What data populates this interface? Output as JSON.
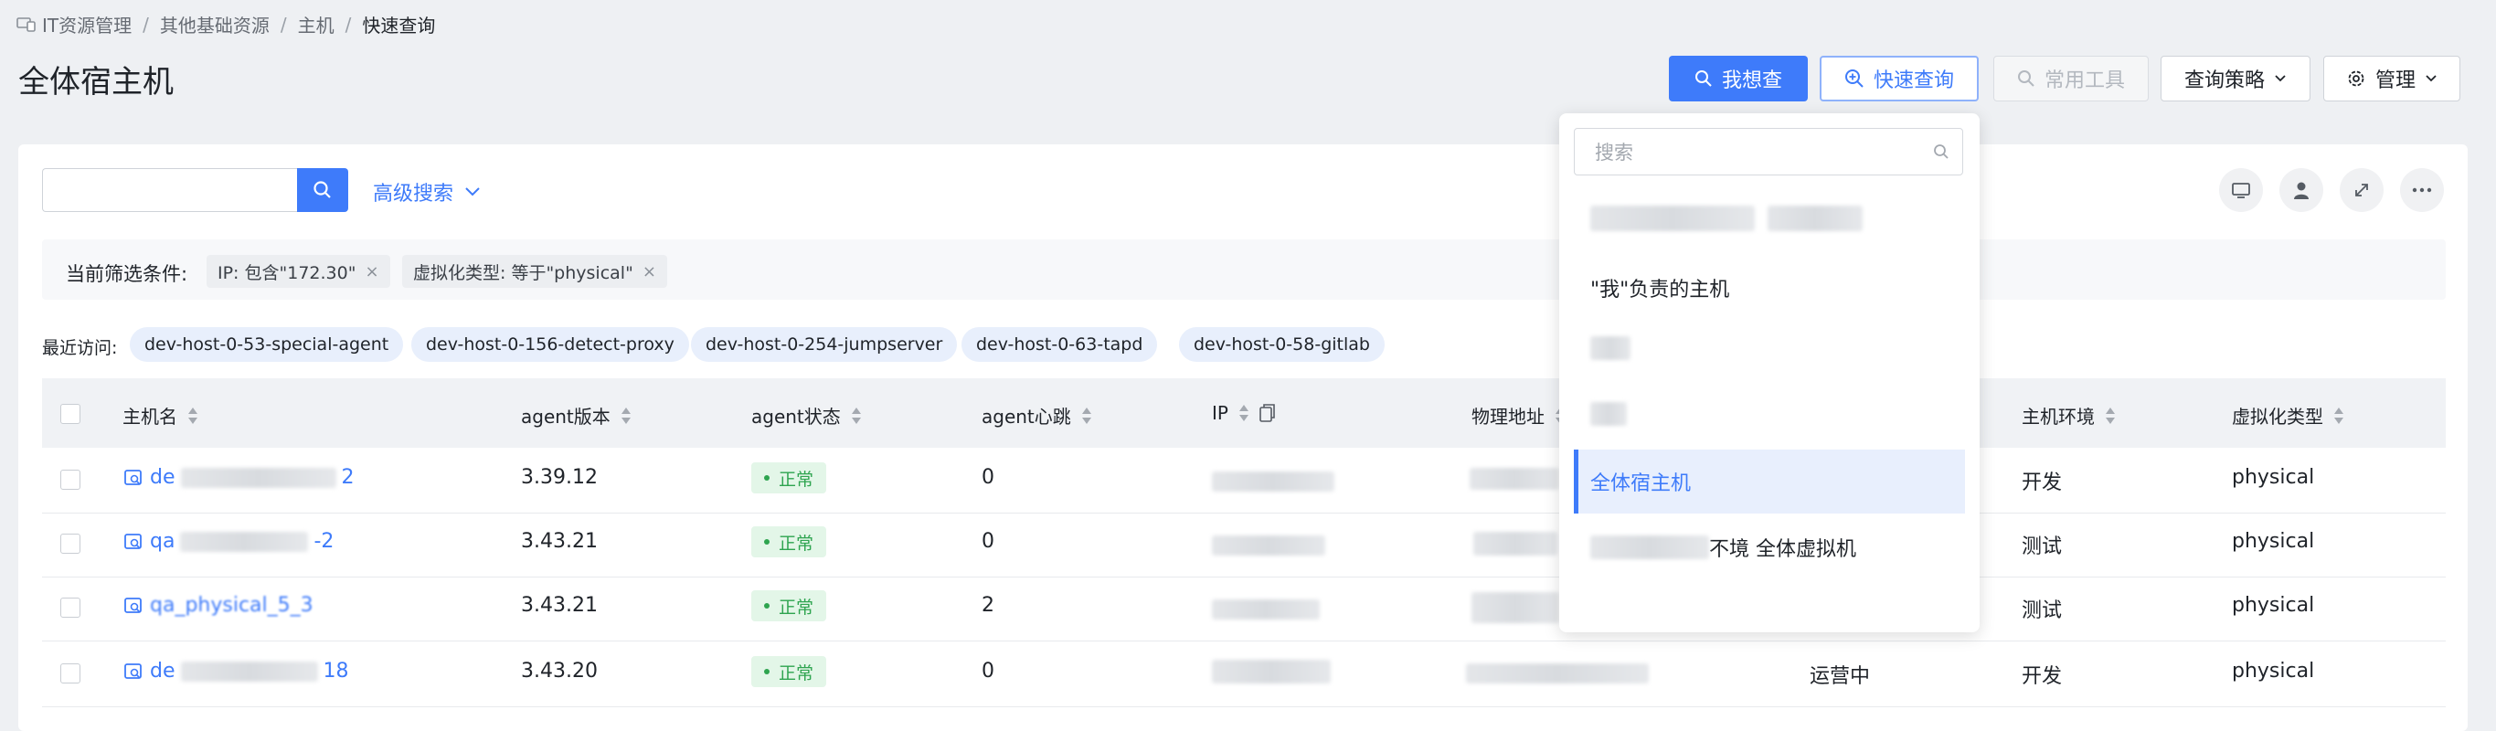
{
  "breadcrumb": {
    "items": [
      "IT资源管理",
      "其他基础资源",
      "主机"
    ],
    "current": "快速查询",
    "separator": "/"
  },
  "page_title": "全体宿主机",
  "toolbar": {
    "i_want_query": "我想查",
    "quick_query": "快速查询",
    "common_tools": "常用工具",
    "query_strategy": "查询策略",
    "manage": "管理"
  },
  "search": {
    "value": "",
    "advanced_label": "高级搜索"
  },
  "filters": {
    "label": "当前筛选条件:",
    "chips": [
      "IP: 包含\"172.30\"",
      "虚拟化类型: 等于\"physical\""
    ]
  },
  "recent": {
    "label": "最近访问:",
    "items": [
      "dev-host-0-53-special-agent",
      "dev-host-0-156-detect-proxy",
      "dev-host-0-254-jumpserver",
      "dev-host-0-63-tapd",
      "dev-host-0-58-gitlab"
    ]
  },
  "table": {
    "columns": [
      "主机名",
      "agent版本",
      "agent状态",
      "agent心跳",
      "IP",
      "物理地址",
      "主机环境",
      "虚拟化类型"
    ],
    "rows": [
      {
        "hostname_start": "de",
        "hostname_end": "2",
        "agent_version": "3.39.12",
        "status": "正常",
        "heartbeat": "0",
        "lifecycle": "",
        "env": "开发",
        "virt": "physical"
      },
      {
        "hostname_start": "qa",
        "hostname_end": "-2",
        "agent_version": "3.43.21",
        "status": "正常",
        "heartbeat": "0",
        "lifecycle": "",
        "env": "测试",
        "virt": "physical"
      },
      {
        "hostname_start": "qa_physical_5_3",
        "hostname_end": "",
        "agent_version": "3.43.21",
        "status": "正常",
        "heartbeat": "2",
        "lifecycle": "",
        "env": "测试",
        "virt": "physical"
      },
      {
        "hostname_start": "de",
        "hostname_end": "18",
        "agent_version": "3.43.20",
        "status": "正常",
        "heartbeat": "0",
        "lifecycle": "运营中",
        "env": "开发",
        "virt": "physical"
      }
    ]
  },
  "dropdown": {
    "search_placeholder": "搜索",
    "items": [
      "",
      "\"我\"负责的主机",
      "",
      "",
      "全体宿主机",
      "不境 全体虚拟机"
    ],
    "active_index": 4
  },
  "colors": {
    "primary": "#3e7bfa",
    "success": "#2ea44f"
  }
}
